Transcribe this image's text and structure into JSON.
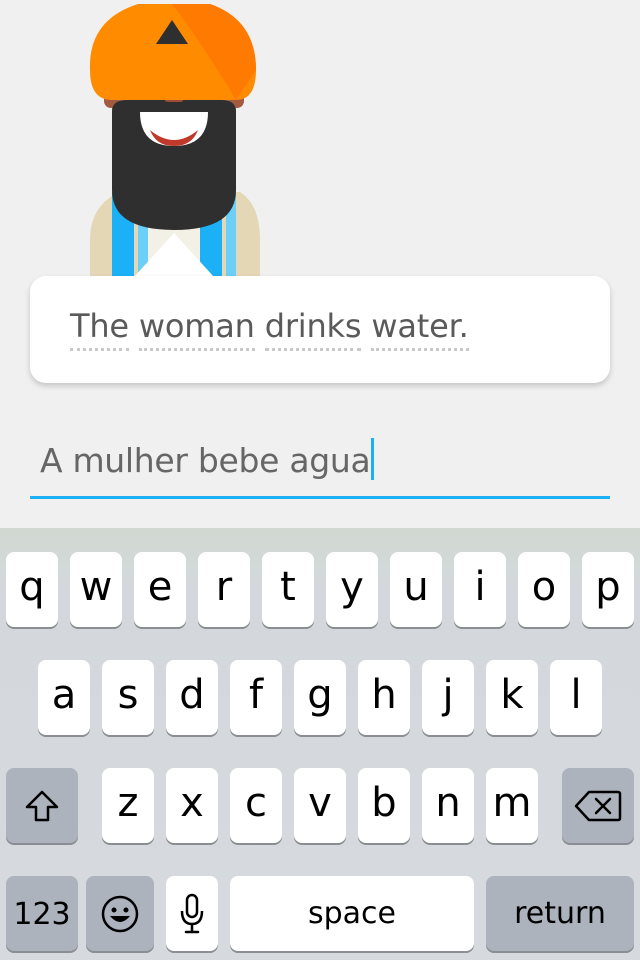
{
  "lesson": {
    "prompt_words": [
      "The",
      "woman",
      "drinks",
      "water."
    ],
    "answer_value": "A mulher bebe agua"
  },
  "keyboard": {
    "row1": [
      "q",
      "w",
      "e",
      "r",
      "t",
      "y",
      "u",
      "i",
      "o",
      "p"
    ],
    "row2": [
      "a",
      "s",
      "d",
      "f",
      "g",
      "h",
      "j",
      "k",
      "l"
    ],
    "row3": [
      "z",
      "x",
      "c",
      "v",
      "b",
      "n",
      "m"
    ],
    "numbers_label": "123",
    "space_label": "space",
    "return_label": "return",
    "shift_icon": "shift-icon",
    "delete_icon": "backspace-icon",
    "emoji_icon": "emoji-icon",
    "mic_icon": "microphone-icon"
  },
  "colors": {
    "accent": "#1cb0f6",
    "turban": "#ff8c00",
    "skin": "#b86c4e",
    "beard": "#2e2e2e",
    "shirt_stripe": "#1cb0f6",
    "vest": "#e6d8b8"
  }
}
